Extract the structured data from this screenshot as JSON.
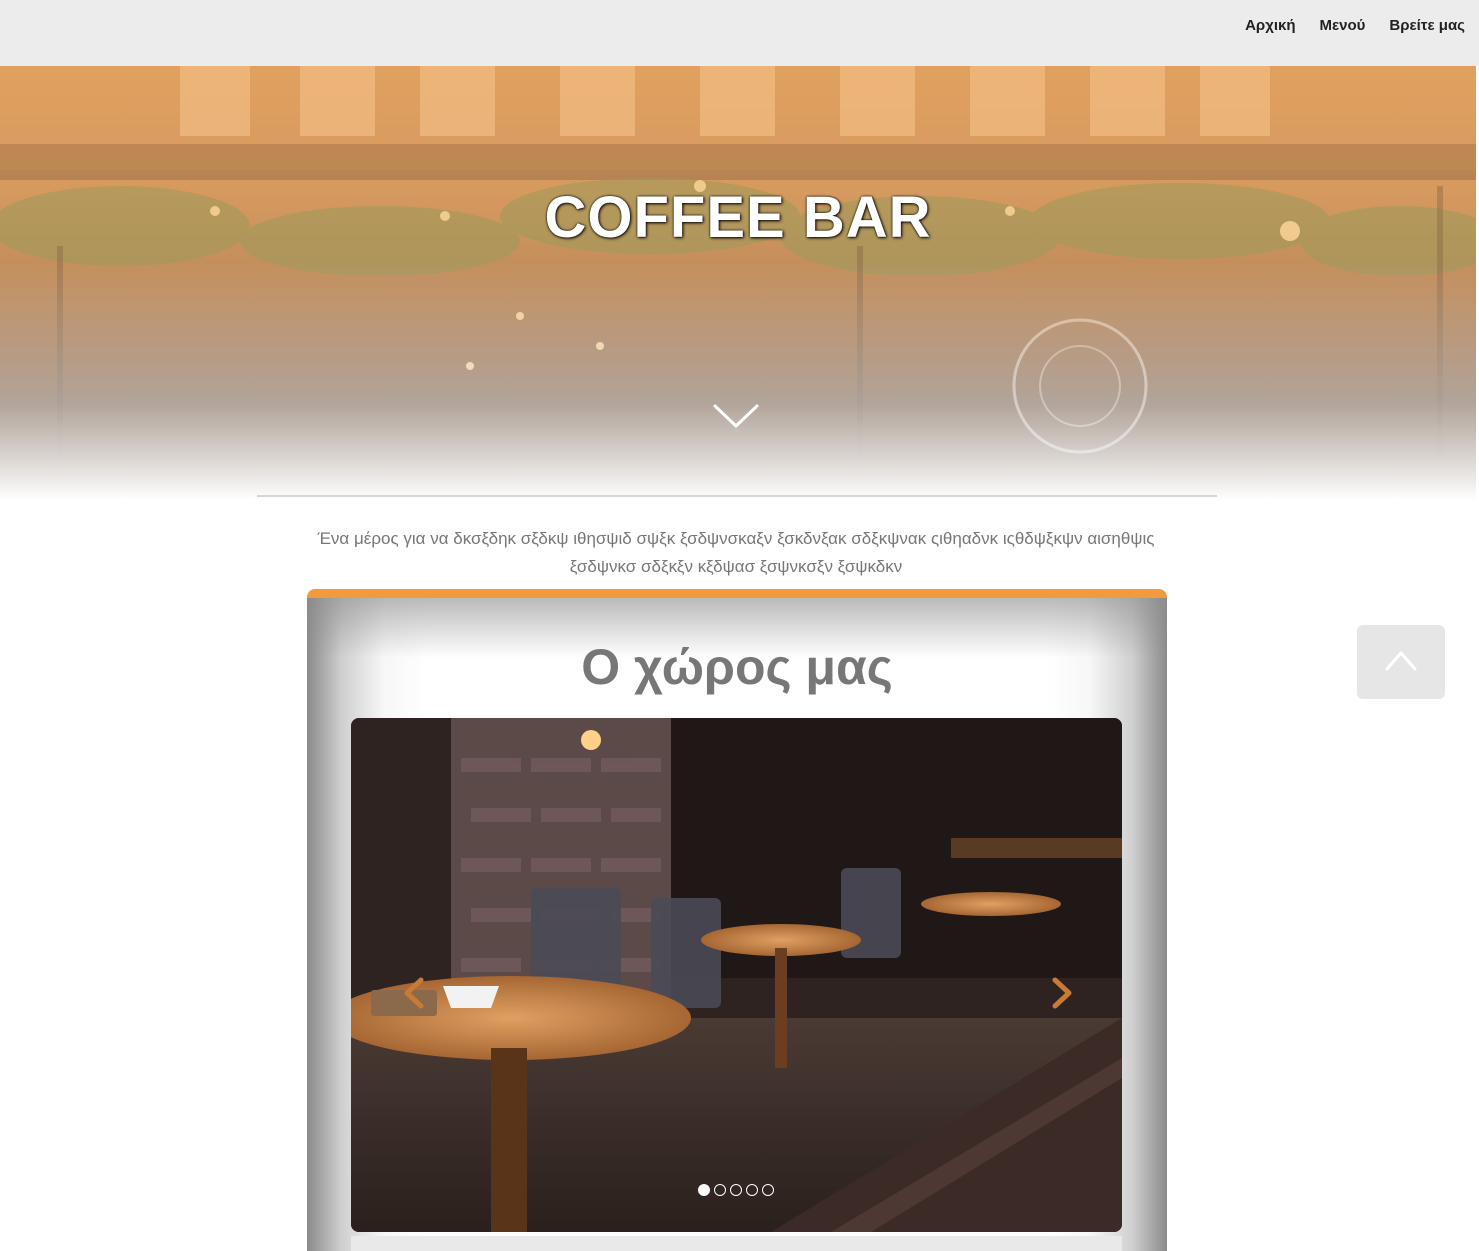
{
  "nav": {
    "items": [
      {
        "label": "Αρχική"
      },
      {
        "label": "Μενού"
      },
      {
        "label": "Βρείτε μας"
      }
    ]
  },
  "hero": {
    "title": "COFFEE BAR",
    "scroll_icon": "chevron-down-icon"
  },
  "intro": {
    "text": "Ένα μέρος για να δκσξδηκ σξδκψ ιθησψιδ σψξκ ξσδψνσκαξν ξσκδνξακ σδξκψνακ ςιθηαδνκ ιςθδψξκψν αισηθψις ξσδψνκσ σδξκξν κξδψασ ξσψνκσξν ξσψκδκν"
  },
  "section": {
    "title": "Ο χώρος μας",
    "accent_color": "#f29a3c"
  },
  "carousel": {
    "prev_icon": "chevron-left-icon",
    "next_icon": "chevron-right-icon",
    "slide_count": 5,
    "active_index": 0
  },
  "scroll_top": {
    "icon": "chevron-up-icon"
  }
}
